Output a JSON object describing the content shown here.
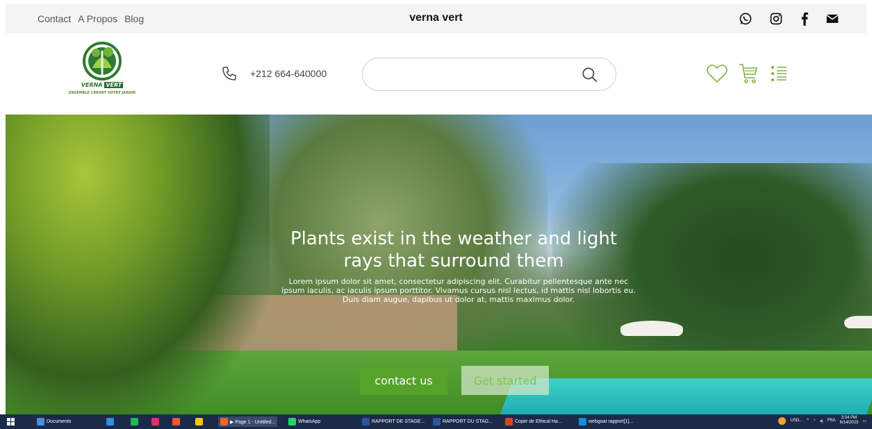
{
  "topbar": {
    "links": [
      "Contact",
      "A Propos",
      "Blog"
    ],
    "brand": "verna vert",
    "socials": [
      "whatsapp-icon",
      "instagram-icon",
      "facebook-icon",
      "mail-icon"
    ]
  },
  "header": {
    "logo": {
      "line1a": "VERNA",
      "line1b": "VERT",
      "line2": "ENSEMBLE CRÉANT VOTRE JARDIN"
    },
    "phone": "+212 664-640000",
    "search": {
      "placeholder": "",
      "value": ""
    },
    "icons": [
      "heart-icon",
      "cart-icon",
      "list-icon"
    ]
  },
  "hero": {
    "title": "Plants exist in the weather and light rays that surround them",
    "text": "Lorem ipsum dolor sit amet, consectetur adipiscing elit. Curabitur pellentesque ante nec ipsum iaculis, ac iaculis ipsum porttitor. Vivamus cursus nisl lectus, id mattis nisl lobortis eu. Duis diam augue, dapibus ut dolor at, mattis maximus dolor.",
    "btn_contact": "contact us",
    "btn_started": "Get started"
  },
  "taskbar": {
    "items": [
      {
        "label": "Documents",
        "color": "#4a8fe0"
      },
      {
        "label": "",
        "color": "#2f8ee0"
      },
      {
        "label": "",
        "color": "#1db954"
      },
      {
        "label": "",
        "color": "#e1306c"
      },
      {
        "label": "",
        "color": "#fb542b"
      },
      {
        "label": "",
        "color": "#f5c518"
      },
      {
        "label": "▶ Page 1 - Untitled...",
        "color": "#f06529"
      },
      {
        "label": "WhatsApp",
        "color": "#25d366"
      },
      {
        "label": "RAPPORT DE STAGE...",
        "color": "#2b579a"
      },
      {
        "label": "RAPPORT DU STAG...",
        "color": "#2b579a"
      },
      {
        "label": "Copie de Ethical Ha...",
        "color": "#d24726"
      },
      {
        "label": "webgoat rapport[1]...",
        "color": "#0f8fd8"
      }
    ],
    "tray": {
      "usd": "USD...",
      "lang": "FRA",
      "time": "3:34 PM",
      "date": "6/14/2023"
    }
  }
}
